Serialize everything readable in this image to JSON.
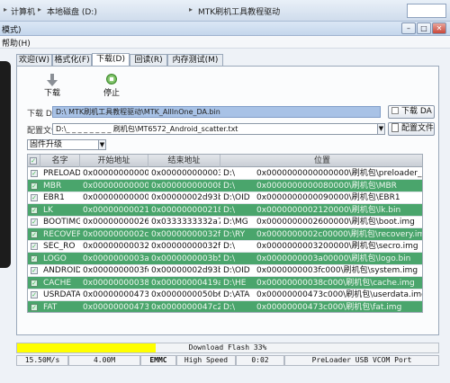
{
  "explorer": {
    "crumbs": [
      "计算机",
      "本地磁盘 (D:)",
      "MTK刷机工具教程驱动"
    ],
    "separator": "▸"
  },
  "window": {
    "title": "模式)",
    "min": "–",
    "max": "□",
    "close": "✕"
  },
  "menu": {
    "help": "帮助(H)"
  },
  "tabs": [
    "欢迎(W)",
    "格式化(F)",
    "下载(D)",
    "回读(R)",
    "内存测试(M)"
  ],
  "active_tab": 2,
  "toolbar": {
    "download_label": "下载",
    "stop_label": "停止"
  },
  "download_agent": {
    "label": "下载 DA",
    "path": "D:\\         MTK刷机工具教程驱动\\MTK_AllInOne_DA.bin",
    "button": "下载 DA"
  },
  "scatter": {
    "label": "配置文件",
    "path": "D:\\_ _ _ _ _ _ _ _          刷机包\\MT6572_Android_scatter.txt",
    "button": "配置文件"
  },
  "mode": {
    "selected": "固件升级"
  },
  "table": {
    "headers": [
      "名字",
      "开始地址",
      "结束地址",
      "位置"
    ],
    "rows": [
      {
        "name": "PRELOADER",
        "start": "0x0000000000000000",
        "end": "0x000000000003220ff",
        "region": "D:\\",
        "location": "0x0000000000000000\\刷机包\\preloader_gionee72_..."
      },
      {
        "name": "MBR",
        "start": "0x0000000000080000",
        "end": "0x00000000000801ff",
        "region": "D:\\",
        "location": "0x0000000000080000\\刷机包\\MBR"
      },
      {
        "name": "EBR1",
        "start": "0x0000000000090000",
        "end": "0x00000002d93bbb7",
        "region": "D:\\OID",
        "location": "0x0000000000090000\\刷机包\\EBR1"
      },
      {
        "name": "LK",
        "start": "0x0000000002120000",
        "end": "0x0000000002185a0",
        "region": "D:\\",
        "location": "0x0000000002120000\\刷机包\\lk.bin"
      },
      {
        "name": "BOOTIMG",
        "start": "0x0000000002600000",
        "end": "0x0333333332a7fff",
        "region": "D:\\MG",
        "location": "0x0000000002600000\\刷机包\\boot.img"
      },
      {
        "name": "RECOVERY",
        "start": "0x0000000002c00000",
        "end": "0x00000000032fffff",
        "region": "D:\\RY",
        "location": "0x0000000002c00000\\刷机包\\recovery.img"
      },
      {
        "name": "SEC_RO",
        "start": "0x0000000003200000",
        "end": "0x00000000032fffff",
        "region": "D:\\",
        "location": "0x0000000003200000\\刷机包\\secro.img"
      },
      {
        "name": "LOGO",
        "start": "0x0000000003a00000",
        "end": "0x0000000003b5f7ff",
        "region": "D:\\",
        "location": "0x0000000003a00000\\刷机包\\logo.bin"
      },
      {
        "name": "ANDROID",
        "start": "0x0000000003fc0000",
        "end": "0x00000002d93bbb7",
        "region": "D:\\OID",
        "location": "0x0000000003fc000\\刷机包\\system.img"
      },
      {
        "name": "CACHE",
        "start": "0x00000000038c0000",
        "end": "0x00000000419ad7",
        "region": "D:\\HE",
        "location": "0x00000000038c000\\刷机包\\cache.img"
      },
      {
        "name": "USRDATA",
        "start": "0x00000000473c0000",
        "end": "0x0000000050b6f24f",
        "region": "D:\\ATA",
        "location": "0x00000000473c000\\刷机包\\userdata.img"
      },
      {
        "name": "FAT",
        "start": "0x00000000473c0000",
        "end": "0x0000000047c2217",
        "region": "D:\\",
        "location": "0x00000000473c000\\刷机包\\fat.img"
      }
    ]
  },
  "progress": {
    "text": "Download Flash 33%",
    "percent": 33
  },
  "status": {
    "speed": "15.50M/s",
    "size": "4.00M",
    "storage": "EMMC",
    "usb": "High Speed",
    "time": "0:02",
    "port": "PreLoader USB VCOM Port"
  }
}
